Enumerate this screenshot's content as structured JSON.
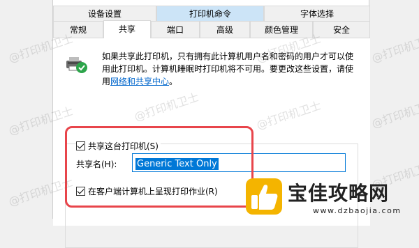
{
  "tabs_row1": [
    "设备设置",
    "打印机命令",
    "字体选择"
  ],
  "tabs_row2": [
    "常规",
    "共享",
    "端口",
    "高级",
    "颜色管理",
    "安全"
  ],
  "description": {
    "text": "如果共享此打印机，只有拥有此计算机用户名和密码的用户才可以使用此打印机。计算机睡眠时打印机将不可用。要更改这些设置，请使用",
    "link": "网络和共享中心",
    "end": "。"
  },
  "share_checkbox_label": "共享这台打印机(S)",
  "share_name_label": "共享名(H):",
  "share_name_value": "Generic  Text Only",
  "render_checkbox_label": "在客户端计算机上呈现打印作业(R)",
  "watermark_text": "@打印机卫士",
  "logo": {
    "title": "宝佳攻略网",
    "url": "www.dzbaojia.com"
  },
  "colors": {
    "accent": "#0078d7",
    "highlight": "#cce4f7",
    "annotation": "#e8454b"
  }
}
